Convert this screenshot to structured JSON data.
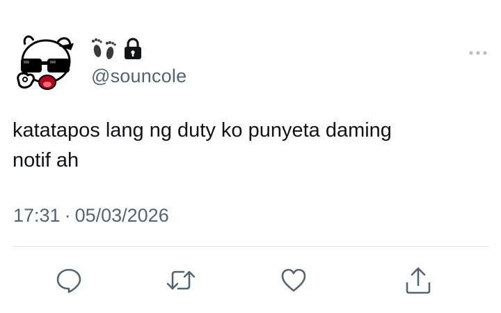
{
  "tweet": {
    "display_name_icons": [
      "footprints-icon",
      "lock-icon"
    ],
    "handle": "@souncole",
    "text": "katatapos lang ng duty ko punyeta daming\nnotif ah",
    "time": "17:31",
    "separator": "·",
    "date": "05/03/2026"
  },
  "actions": [
    {
      "name": "reply",
      "icon": "reply-icon"
    },
    {
      "name": "retweet",
      "icon": "retweet-icon"
    },
    {
      "name": "like",
      "icon": "heart-icon"
    },
    {
      "name": "share",
      "icon": "share-icon"
    }
  ],
  "colors": {
    "text": "#0f1419",
    "secondary": "#536471",
    "divider": "#dfe3e6"
  }
}
